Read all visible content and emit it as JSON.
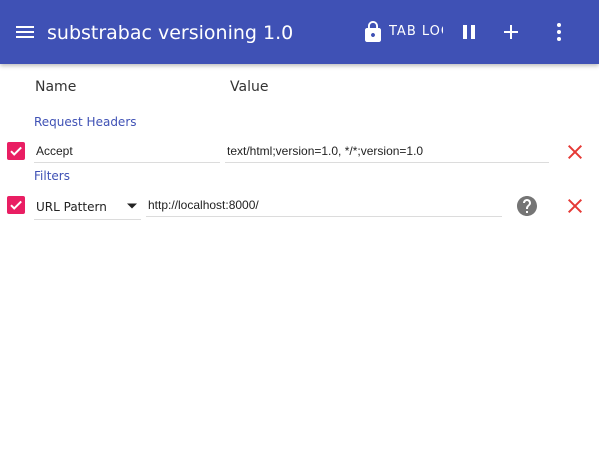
{
  "appbar": {
    "title": "substrabac versioning 1.0",
    "tab_lock_label": "TAB LOCK",
    "background": "#3f51b5"
  },
  "columns": {
    "name": "Name",
    "value": "Value"
  },
  "request_headers": {
    "section_title": "Request Headers",
    "rows": [
      {
        "enabled": true,
        "name": "Accept",
        "value": "text/html;version=1.0, */*;version=1.0"
      }
    ]
  },
  "filters": {
    "section_title": "Filters",
    "rows": [
      {
        "enabled": true,
        "type": "URL Pattern",
        "value": "http://localhost:8000/"
      }
    ]
  },
  "colors": {
    "accent": "#e91e63",
    "primary": "#3f51b5",
    "delete": "#e53935",
    "help": "#757575"
  },
  "icons": [
    "menu-icon",
    "lock-icon",
    "pause-icon",
    "add-icon",
    "more-vert-icon",
    "check-icon",
    "close-icon",
    "help-icon",
    "dropdown-arrow-icon"
  ]
}
